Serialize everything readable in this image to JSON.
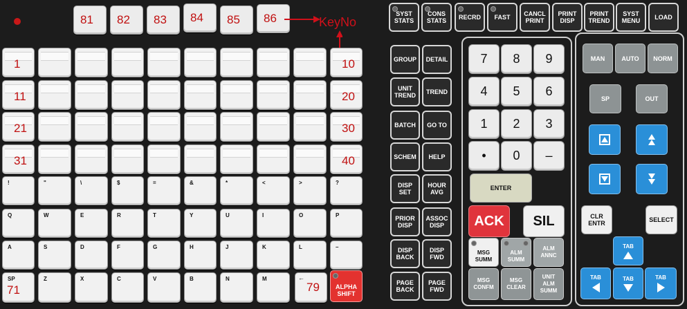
{
  "annotation": {
    "label": "KeyNo"
  },
  "function_keys": [
    "81",
    "82",
    "83",
    "84",
    "85",
    "86"
  ],
  "grid": {
    "row1": [
      "1",
      "",
      "",
      "",
      "",
      "",
      "",
      "",
      "",
      "10"
    ],
    "row2": [
      "11",
      "",
      "",
      "",
      "",
      "",
      "",
      "",
      "",
      "20"
    ],
    "row3": [
      "21",
      "",
      "",
      "",
      "",
      "",
      "",
      "",
      "",
      "30"
    ],
    "row4": [
      "31",
      "",
      "",
      "",
      "",
      "",
      "",
      "",
      "",
      "40"
    ],
    "row5": [
      "!",
      "\"",
      "\\",
      "$",
      "=",
      "&",
      "*",
      "<",
      ">",
      "?"
    ],
    "row6": [
      "Q",
      "W",
      "E",
      "R",
      "T",
      "Y",
      "U",
      "I",
      "O",
      "P"
    ],
    "row7": [
      "A",
      "S",
      "D",
      "F",
      "G",
      "H",
      "J",
      "K",
      "L",
      "–"
    ],
    "row8": [
      "SP",
      "Z",
      "X",
      "C",
      "V",
      "B",
      "N",
      "M",
      "←"
    ],
    "key71": "71",
    "key79": "79",
    "alpha_shift": "ALPHA\nSHIFT"
  },
  "top_display_keys": [
    "SYST\nSTATS",
    "CONS\nSTATS",
    "RECRD",
    "FAST",
    "CANCL\nPRINT",
    "PRINT\nDISP",
    "PRINT\nTREND",
    "SYST\nMENU",
    "LOAD"
  ],
  "display_keys": [
    [
      "GROUP",
      "DETAIL"
    ],
    [
      "UNIT\nTREND",
      "TREND"
    ],
    [
      "BATCH",
      "GO TO"
    ],
    [
      "SCHEM",
      "HELP"
    ],
    [
      "DISP\nSET",
      "HOUR\nAVG"
    ],
    [
      "PRIOR\nDISP",
      "ASSOC\nDISP"
    ],
    [
      "DISP\nBACK",
      "DISP\nFWD"
    ],
    [
      "PAGE\nBACK",
      "PAGE\nFWD"
    ]
  ],
  "numpad": {
    "keys": [
      "7",
      "8",
      "9",
      "4",
      "5",
      "6",
      "1",
      "2",
      "3",
      "•",
      "0",
      "–"
    ],
    "enter": "ENTER",
    "ack": "ACK",
    "sil": "SIL",
    "msg_summ": "MSG\nSUMM",
    "alm_summ": "ALM\nSUMM",
    "alm_annc": "ALM\nANNC",
    "msg_confm": "MSG\nCONFM",
    "msg_clear": "MSG\nCLEAR",
    "unit_alm_summ": "UNIT\nALM\nSUMM"
  },
  "control": {
    "man": "MAN",
    "auto": "AUTO",
    "norm": "NORM",
    "sp": "SP",
    "out": "OUT",
    "clr_entr": "CLR\nENTR",
    "select": "SELECT",
    "tab": "TAB"
  },
  "colors": {
    "ack": "#e0343c",
    "blue": "#2a8fd8",
    "alpha_shift": "#e3322f",
    "annotation": "#d0101a"
  }
}
